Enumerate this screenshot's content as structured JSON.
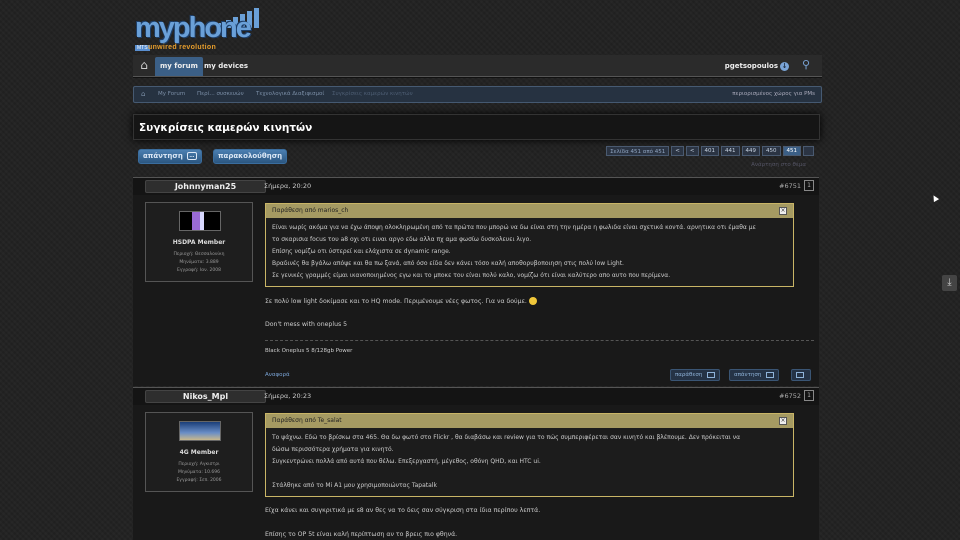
{
  "logo": {
    "text": "myphone",
    "sub": "unwired revolution",
    "badge": "MTS"
  },
  "nav": {
    "tabs": [
      "my forum",
      "my devices"
    ],
    "username": "pgetsopoulos"
  },
  "breadcrumb": {
    "items": [
      "My Forum",
      "Περί... συσκευών",
      "Τεχνολογικά Διαξιφισμοί",
      "Συγκρίσεις καμερών κινητών"
    ],
    "right": "περιορισμένος χώρος για PMs"
  },
  "thread": {
    "title": "Συγκρίσεις καμερών κινητών"
  },
  "buttons": {
    "reply": "απάντηση",
    "follow": "παρακολούθηση"
  },
  "pager": {
    "label": "Σελίδα 451 από 451",
    "first": "<",
    "prev": "<",
    "pages": [
      "401",
      "441",
      "449",
      "450",
      "451"
    ],
    "current": "451",
    "sub": "Ανάρτηση στο θέμα"
  },
  "posts": [
    {
      "username": "Johnnyman25",
      "date": "Σήμερα, 20:20",
      "number": "#6751",
      "box": "1",
      "rank": "HSDPA Member",
      "info": [
        "Περιοχή: Θεσσαλονίκη",
        "Μηνύματα: 3.889",
        "Εγγραφή: Ιαν. 2008"
      ],
      "quote_head": "Παράθεση από marios_ch",
      "quote_lines": [
        "Είναι νωρίς ακόμα για να έχω άποψη ολοκληρωμένη από τα πρώτα που μπορώ να δω είναι στη την ημέρα η φωλιδα είναι σχετικά κοντά. αρνητικα οτι έμαθα με",
        "το σκαρισια focus του a8 οχι οτι ειναι αργο εδω αλλα πχ αμα φωσίω δυσκολευει λιγο.",
        "Επίσης νομίζω οτι ύστερεί και ελάχιστα σε dynamic range.",
        "Βραδινές θα βγάλω απόψε και θα πω ξανά, από όσο είδα δεν κάνει τόσο καλή αποθορυβοποιηση στις πολύ low Light.",
        "Σε γενικές γραμμές είμαι ικανοποιημένος εγω και το μποκε του είναι πολύ καλο, νομίζω ότι είναι καλύτερο απο αυτο που περίμενα."
      ],
      "lines": [
        "Σε πολύ low light δοκίμασε και το HQ mode. Περιμένουμε νέες φωτος. Για να δούμε.",
        "Don't mess with oneplus 5"
      ],
      "signature": "Black Oneplus 5 8/128gb Power",
      "report": "Αναφορά",
      "actions": [
        "παράθεση",
        "απάντηση"
      ]
    },
    {
      "username": "Nikos_Mpl",
      "date": "Σήμερα, 20:23",
      "number": "#6752",
      "box": "1",
      "rank": "4G Member",
      "info": [
        "Περιοχή: Αγκιστρι",
        "Μηνύματα: 10.696",
        "Εγγραφή: Σεπ. 2006"
      ],
      "quote_head": "Παράθεση από Te_salat",
      "quote_lines": [
        "Το ψάχνω. Εδώ το βρίσκω στα 465. Θα δω φωτό στο Flickr , θα διαβάσω και review για το πώς συμπεριφέρεται σαν κινητό και βλέπουμε. Δεν πρόκειται να",
        "δώσω περισσότερα χρήματα για κινητό.",
        "Συγκεντρώνει πολλά από αυτά που θέλω. Επεξεργαστή, μέγεθος, οθόνη QHD, και HTC ui.",
        "",
        "Στάλθηκε από το Mi A1 μου χρησιμοποιώντας Tapatalk"
      ],
      "lines": [
        "Είχα κάνει και συγκριτικά με s8 αν θες να το δεις σαν σύγκριση στα ίδια περίπου λεπτά.",
        "Επίσης το OP 5t είναι καλή περίπτωση αν το βρεις πιο φθηνά."
      ]
    }
  ],
  "colors": {
    "accent": "#3b5f86",
    "quote_border": "#c9b566",
    "quote_head": "#a59a62",
    "link": "#7aa4d6"
  }
}
